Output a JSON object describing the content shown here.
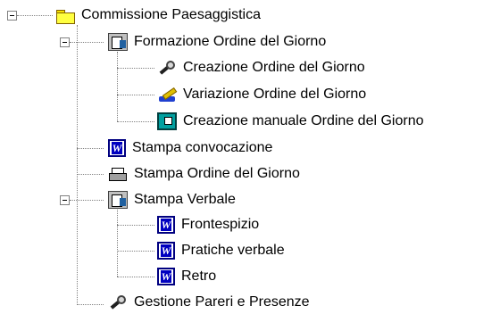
{
  "tree": {
    "root": {
      "label": "Commissione Paesaggistica",
      "icon": "folder-icon"
    },
    "formazione": {
      "label": "Formazione Ordine del Giorno",
      "icon": "form-icon"
    },
    "creazione": {
      "label": "Creazione Ordine del Giorno",
      "icon": "tools-icon"
    },
    "variazione": {
      "label": "Variazione Ordine del Giorno",
      "icon": "edit-icon"
    },
    "manuale": {
      "label": "Creazione manuale Ordine del Giorno",
      "icon": "manual-icon"
    },
    "convocazione": {
      "label": "Stampa convocazione",
      "icon": "word-icon"
    },
    "stampa_odg": {
      "label": "Stampa Ordine del Giorno",
      "icon": "printer-icon"
    },
    "stampa_verbale": {
      "label": "Stampa Verbale",
      "icon": "form-icon"
    },
    "frontespizio": {
      "label": "Frontespizio",
      "icon": "word-icon"
    },
    "pratiche": {
      "label": "Pratiche verbale",
      "icon": "word-icon"
    },
    "retro": {
      "label": "Retro",
      "icon": "word-icon"
    },
    "gestione": {
      "label": "Gestione Pareri e Presenze",
      "icon": "tools-icon"
    }
  },
  "icon_word_letter": "W"
}
